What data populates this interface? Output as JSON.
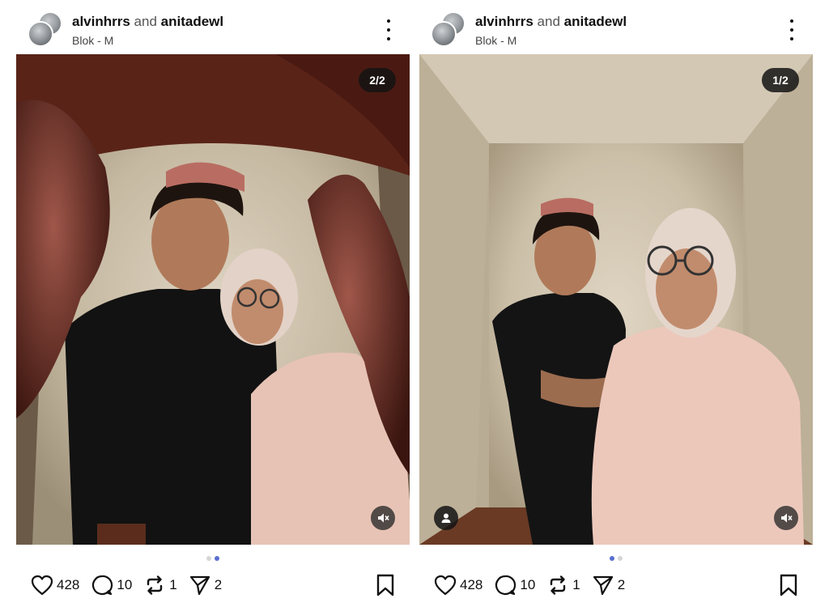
{
  "posts": [
    {
      "author_1": "alvinhrrs",
      "joiner": "and",
      "author_2": "anitadewl",
      "location": "Blok - M",
      "counter": "2/2",
      "active_dot": 1,
      "likes": "428",
      "comments": "10",
      "reposts": "1",
      "shares": "2"
    },
    {
      "author_1": "alvinhrrs",
      "joiner": "and",
      "author_2": "anitadewl",
      "location": "Blok - M",
      "counter": "1/2",
      "active_dot": 0,
      "likes": "428",
      "comments": "10",
      "reposts": "1",
      "shares": "2"
    }
  ],
  "icons": {
    "more": "more-options-icon",
    "mute": "muted-speaker-icon",
    "tag": "person-tag-icon",
    "like": "heart-icon",
    "comment": "comment-bubble-icon",
    "repost": "repost-icon",
    "share": "send-icon",
    "save": "bookmark-icon"
  },
  "colors": {
    "active_dot": "#5a6fd0",
    "inactive_dot": "#d6d6d6",
    "text": "#111111",
    "overlay": "#141414"
  }
}
